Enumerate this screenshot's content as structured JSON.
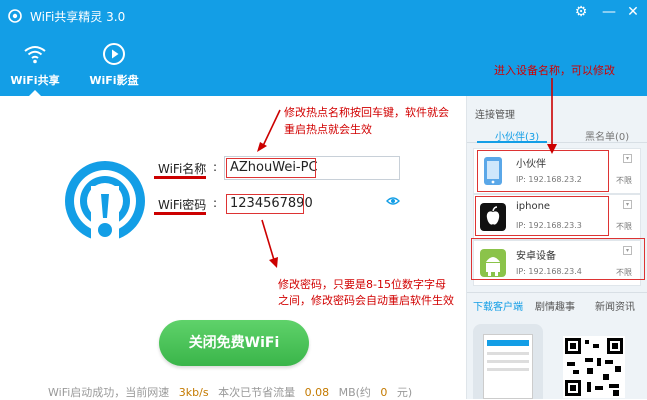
{
  "app": {
    "title": "WiFi共享精灵 3.0"
  },
  "nav": {
    "tabs": [
      {
        "label": "WiFi共享",
        "icon": "wifi-icon",
        "active": true
      },
      {
        "label": "WiFi影盘",
        "icon": "play-icon",
        "active": false
      }
    ]
  },
  "form": {
    "wifi_name_label": "WiFi名称",
    "wifi_name_value": "AZhouWei-PC",
    "wifi_pwd_label": "WiFi密码",
    "wifi_pwd_value": "1234567890",
    "colon": ":"
  },
  "annotations": {
    "name_note_line1": "修改热点名称按回车键，软件就会",
    "name_note_line2": "重启热点就会生效",
    "pwd_note_line1": "修改密码，只要是8-15位数字字母",
    "pwd_note_line2": "之间，修改密码会自动重启软件生效",
    "device_note": "进入设备名称，可以修改"
  },
  "cta": {
    "label": "关闭免费WiFi"
  },
  "status": {
    "prefix": "WiFi启动成功，当前网速",
    "speed": "3kb/s",
    "saved_label": "本次已节省流量",
    "saved_value": "0.08",
    "mb_label": "MB(约",
    "money_value": "0",
    "yuan_label": "元)"
  },
  "sidebar": {
    "heading": "连接管理",
    "tabs": [
      {
        "label": "小伙伴(3)",
        "active": true
      },
      {
        "label": "黑名单(0)",
        "active": false
      }
    ],
    "devices": [
      {
        "name": "小伙伴",
        "ip": "IP: 192.168.23.2",
        "limit": "不限",
        "icon": "phone-icon",
        "color": "#5aa7e8"
      },
      {
        "name": "iphone",
        "ip": "IP: 192.168.23.3",
        "limit": "不限",
        "icon": "apple-icon",
        "color": "#111111"
      },
      {
        "name": "安卓设备",
        "ip": "IP: 192.168.23.4",
        "limit": "不限",
        "icon": "android-icon",
        "color": "#8bc34a"
      }
    ],
    "links": [
      {
        "label": "下载客户端",
        "active": true
      },
      {
        "label": "剧情趣事",
        "active": false
      },
      {
        "label": "新闻资讯",
        "active": false
      }
    ]
  },
  "window": {
    "settings_glyph": "⚙",
    "minimize_glyph": "—",
    "close_glyph": "✕"
  },
  "colors": {
    "header": "#139ee6",
    "cta": "#3ab54a",
    "annotation": "#d10000"
  }
}
